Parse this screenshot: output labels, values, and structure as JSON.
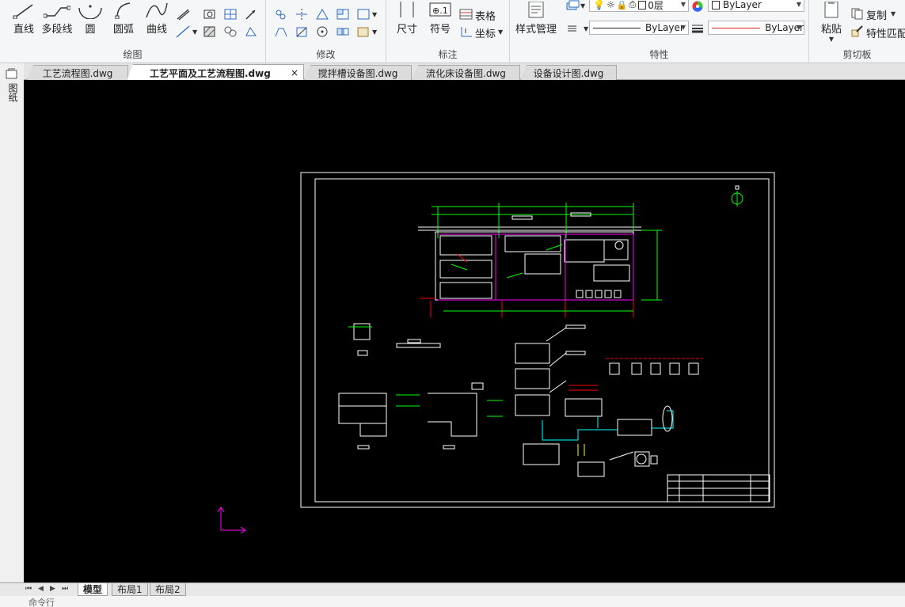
{
  "ribbon": {
    "draw": {
      "title": "绘图",
      "line_label": "直线",
      "polyline_label": "多段线",
      "circle_label": "圆",
      "arc_label": "圆弧",
      "curve_label": "曲线"
    },
    "modify": {
      "title": "修改"
    },
    "annotate": {
      "title": "标注",
      "dimension_label": "尺寸",
      "symbol_label": "符号",
      "table_label": "表格",
      "coord_label": "坐标"
    },
    "properties": {
      "title": "特性",
      "style_manager_label": "样式管理",
      "layer_value": "0层",
      "color_value": "ByLayer",
      "linetype_value": "ByLayer",
      "lineweight_value": "ByLayer"
    },
    "clipboard": {
      "title": "剪切板",
      "paste_label": "粘贴",
      "copy_label": "复制",
      "match_label": "特性匹配"
    }
  },
  "document_tabs": [
    {
      "label": "工艺流程图.dwg"
    },
    {
      "label": "工艺平面及工艺流程图.dwg",
      "active": true,
      "close": "×"
    },
    {
      "label": "搅拌槽设备图.dwg"
    },
    {
      "label": "流化床设备图.dwg"
    },
    {
      "label": "设备设计图.dwg"
    }
  ],
  "left_panel": {
    "label": "图纸"
  },
  "layout_tabs": [
    {
      "label": "模型",
      "active": true
    },
    {
      "label": "布局1"
    },
    {
      "label": "布局2"
    }
  ],
  "command_line": {
    "text": "命令行"
  },
  "colors": {
    "viewport_bg": "#000000",
    "cad_white": "#ffffff",
    "cad_green": "#00ff00",
    "cad_cyan": "#00ffff",
    "cad_magenta": "#ff00ff",
    "cad_red": "#ff0000",
    "cad_yellow": "#ffff00",
    "ucs_icon": "#ff00ff"
  }
}
